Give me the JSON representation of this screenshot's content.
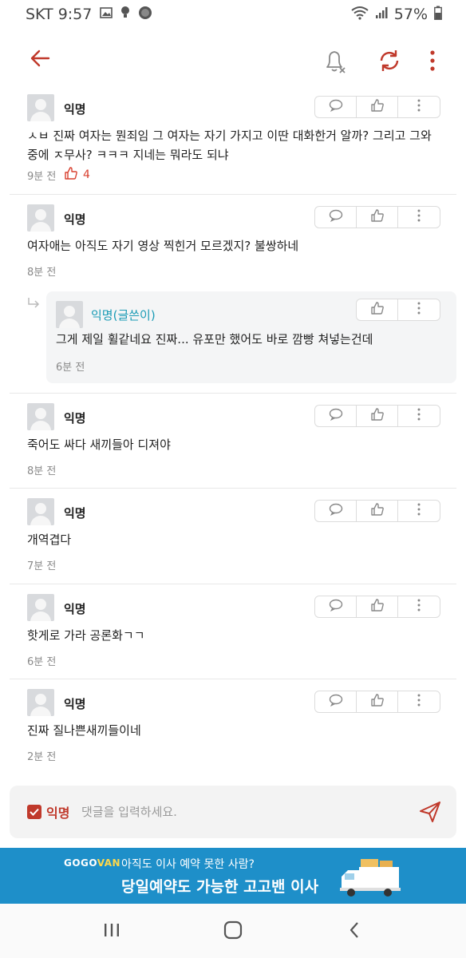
{
  "status_bar": {
    "carrier_time": "SKT 9:57",
    "battery": "57%"
  },
  "icons": {
    "back": "arrow-left-icon",
    "bell": "bell-off-icon",
    "refresh": "refresh-icon",
    "more": "more-vertical-icon",
    "comment": "speech-bubble-icon",
    "like": "thumbs-up-icon",
    "send": "send-icon"
  },
  "colors": {
    "accent": "#d8402f",
    "author_op": "#1a9bb5",
    "ad_background": "#1e8fc9"
  },
  "comments": [
    {
      "author": "익명",
      "text": "ㅅㅂ 진짜 여자는 뭔죄임 그 여자는 자기 가지고 이딴 대화한거 알까? 그리고 그와중에 ㅈ무사? ㅋㅋㅋ 지네는 뭐라도 되냐",
      "time": "9분 전",
      "likes": "4"
    },
    {
      "author": "익명",
      "text": "여자애는 아직도 자기 영상 찍힌거 모르겠지? 불쌍하네",
      "time": "8분 전"
    },
    {
      "author": "익명",
      "text": "죽어도 싸다 새끼들아 디져야",
      "time": "8분 전"
    },
    {
      "author": "익명",
      "text": "개역겹다",
      "time": "7분 전"
    },
    {
      "author": "익명",
      "text": "핫게로 가라 공론화ㄱㄱ",
      "time": "6분 전"
    },
    {
      "author": "익명",
      "text": "진짜 질나쁜새끼들이네",
      "time": "2분 전"
    }
  ],
  "reply": {
    "author": "익명(글쓴이)",
    "text": "그게 제일 휠같네요 진짜... 유포만 했어도 바로 깜빵 쳐넣는건데",
    "time": "6분 전"
  },
  "input": {
    "anonymous_label": "익명",
    "placeholder": "댓글을 입력하세요."
  },
  "ad": {
    "brand_part1": "GOGO",
    "brand_part2": "VAN",
    "line1": "아직도 이사 예약 못한 사람?",
    "line2": "당일예약도 가능한 고고밴 이사"
  }
}
